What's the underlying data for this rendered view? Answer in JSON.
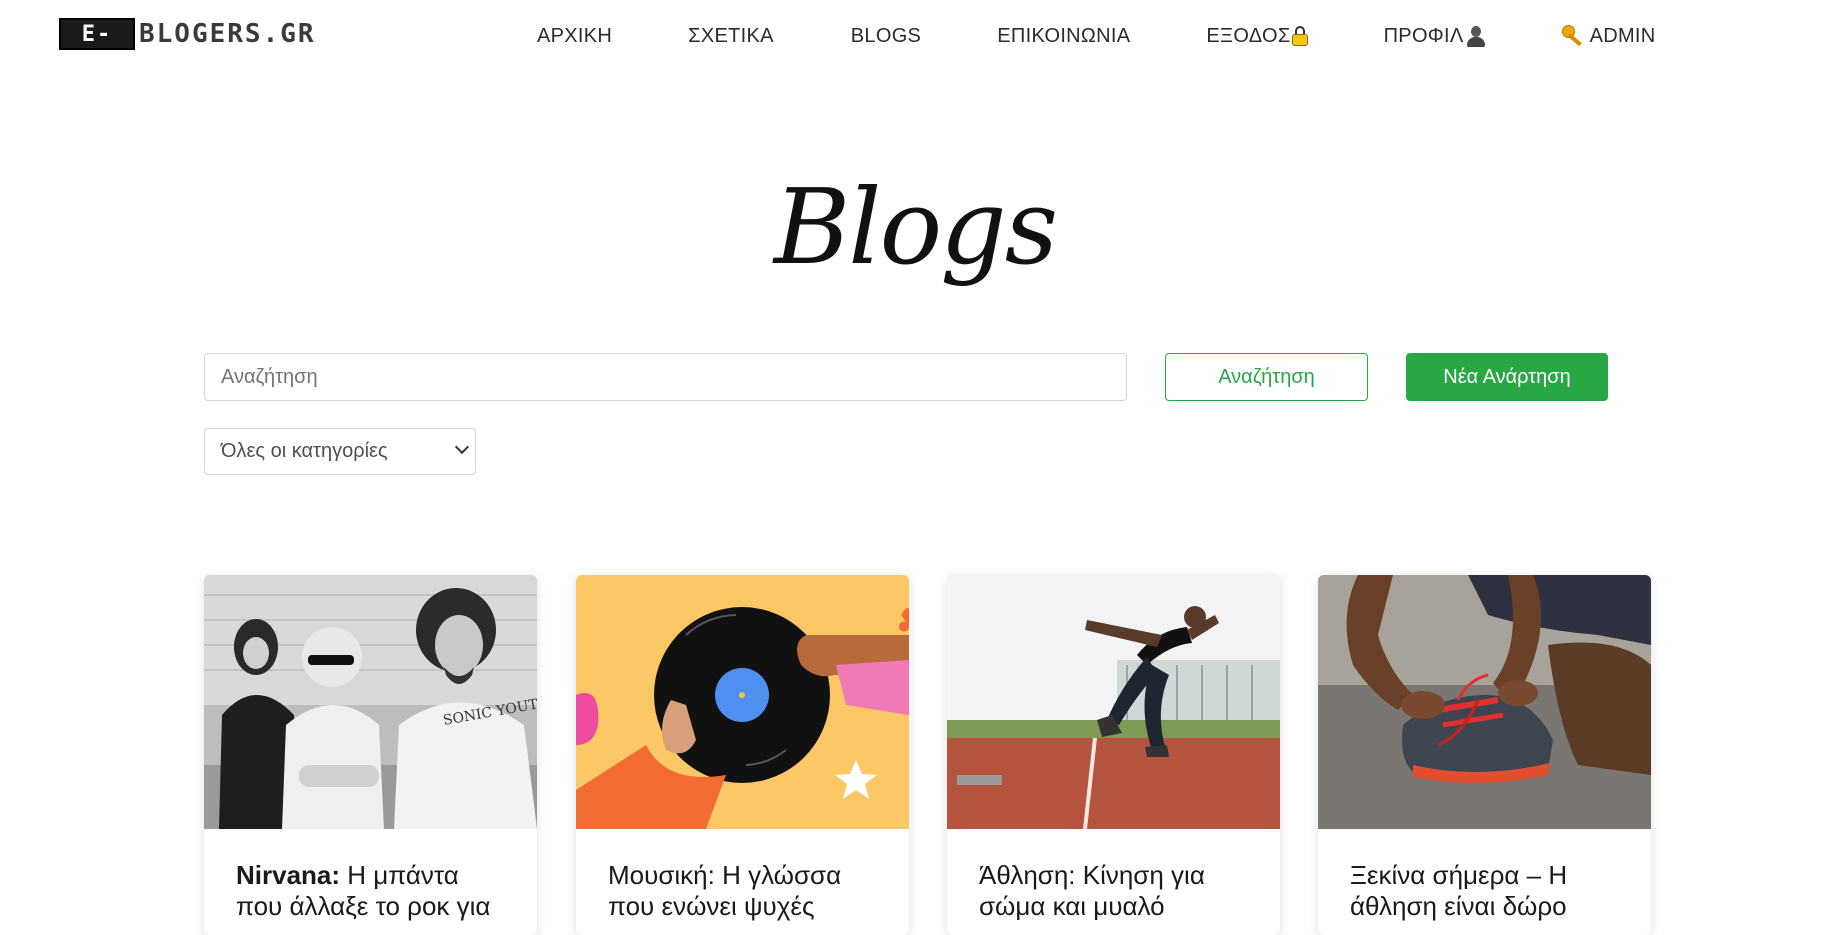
{
  "logo": {
    "box_text": "E-",
    "text": "BLOGERS.GR"
  },
  "nav": {
    "home": "ΑΡΧΙΚΗ",
    "about": "ΣΧΕΤΙΚΑ",
    "blogs": "BLOGS",
    "contact": "ΕΠΙΚΟΙΝΩΝΙΑ",
    "logout": "ΕΞΟΔΟΣ",
    "profile": "ΠΡΟΦΙΛ",
    "admin": "ADMIN"
  },
  "page_title": "Blogs",
  "search": {
    "placeholder": "Αναζήτηση",
    "button_label": "Αναζήτηση",
    "new_post_label": "Νέα Ανάρτηση"
  },
  "category_select": {
    "selected": "Όλες οι κατηγορίες"
  },
  "cards": [
    {
      "title_bold": "Nirvana:",
      "title_rest": " Η μπάντα που άλλαξε το ροκ για",
      "image": "band-photo"
    },
    {
      "title_bold": "",
      "title_rest": "Μουσική: Η γλώσσα που ενώνει ψυχές",
      "image": "vinyl-illustration"
    },
    {
      "title_bold": "",
      "title_rest": "Άθληση: Κίνηση για σώμα και μυαλό",
      "image": "sprinter-photo"
    },
    {
      "title_bold": "",
      "title_rest": "Ξεκίνα σήμερα – Η άθληση είναι δώρο",
      "image": "shoe-lace-photo"
    }
  ],
  "colors": {
    "accent": "#28a745",
    "text": "#212529"
  }
}
